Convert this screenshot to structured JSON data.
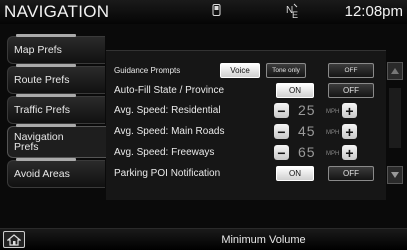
{
  "header": {
    "title": "NAVIGATION",
    "clock": "12:08pm",
    "icons": [
      "phone-icon",
      "compass-icon"
    ]
  },
  "sidebar": {
    "tabs": [
      {
        "label": "Map Prefs",
        "active": false
      },
      {
        "label": "Route Prefs",
        "active": false
      },
      {
        "label": "Traffic Prefs",
        "active": false
      },
      {
        "label": "Navigation Prefs",
        "active": true
      },
      {
        "label": "Avoid Areas",
        "active": false
      }
    ]
  },
  "settings": {
    "guidance_prompts": {
      "label": "Guidance Prompts",
      "options": [
        "Voice",
        "Tone only",
        "OFF"
      ],
      "selected": "Voice"
    },
    "auto_fill_state": {
      "label": "Auto-Fill State / Province",
      "options": [
        "ON",
        "OFF"
      ],
      "selected": "ON"
    },
    "avg_speed_residential": {
      "label": "Avg. Speed: Residential",
      "value": "25",
      "unit": "MPH"
    },
    "avg_speed_main_roads": {
      "label": "Avg. Speed: Main Roads",
      "value": "45",
      "unit": "MPH"
    },
    "avg_speed_freeways": {
      "label": "Avg. Speed: Freeways",
      "value": "65",
      "unit": "MPH"
    },
    "parking_poi_notification": {
      "label": "Parking POI Notification",
      "options": [
        "ON",
        "OFF"
      ],
      "selected": "ON"
    }
  },
  "stepper_symbols": {
    "minus": "−",
    "plus": "+"
  },
  "footer": {
    "status": "Minimum Volume"
  }
}
